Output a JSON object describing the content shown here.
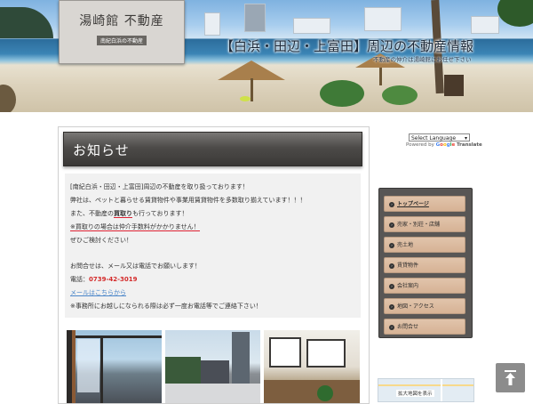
{
  "header": {
    "logo_title": "湯崎館 不動産",
    "logo_subtitle": "南紀白浜の不動産",
    "headline": "【白浜・田辺・上富田】周辺の不動産情報",
    "tagline": "不動産の仲介は湯崎館にお任せ下さい"
  },
  "notice": {
    "title": "お知らせ",
    "lines": {
      "l1": "[南紀白浜・田辺・上富田]周辺の不動産を取り扱っております！",
      "l2": "弊社は、ペットと暮らせる賃貸物件や事業用賃貸物件を多数取り揃えています！！！",
      "l3_pre": "また、不動産の",
      "l3_em": "買取り",
      "l3_post": "も行っております！",
      "l4": "※買取りの場合は仲介手数料がかかりません！",
      "l5": "ぜひご検討ください！",
      "l6": "お問合せは、メール又は電話でお願いします！",
      "phone_label": "電話：",
      "phone": "0739-42-3019",
      "mail_link": "メールはこちらから",
      "l9": "※事務所にお越しになられる際は必ず一度お電話等でご連絡下さい！"
    }
  },
  "translate": {
    "select_value": "Select Language",
    "powered_by": "Powered by",
    "google": [
      "G",
      "o",
      "o",
      "g",
      "l",
      "e"
    ],
    "translate_word": "Translate"
  },
  "nav": {
    "items": [
      {
        "label": "トップページ",
        "active": true
      },
      {
        "label": "売家・別荘・店舗"
      },
      {
        "label": "売土地"
      },
      {
        "label": "賃貸物件"
      },
      {
        "label": "会社案内"
      },
      {
        "label": "地図・アクセス"
      },
      {
        "label": "お問合せ"
      }
    ]
  },
  "map": {
    "label": "拡大地図を表示"
  },
  "icons": {
    "back_to_top": "arrow-up-to-line-icon",
    "nav_bullet": "chevron-right-circle-icon"
  },
  "colors": {
    "notice_bar": "#4d4b49",
    "nav_item": "#d6b295",
    "phone": "#d42a2a",
    "link": "#4b86c9"
  }
}
